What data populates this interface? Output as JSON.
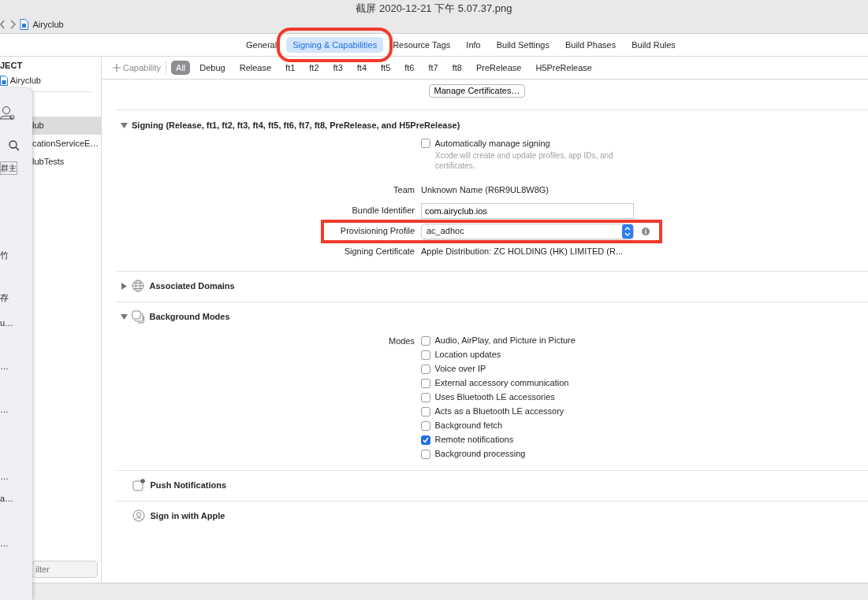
{
  "window": {
    "title": "截屏 2020-12-21 下午 5.07.37.png"
  },
  "toolbar": {
    "breadcrumb": "Airyclub"
  },
  "tabs": [
    {
      "label": "General",
      "selected": false,
      "highlighted": false
    },
    {
      "label": "Signing & Capabilities",
      "selected": true,
      "highlighted": true
    },
    {
      "label": "Resource Tags",
      "selected": false,
      "highlighted": false
    },
    {
      "label": "Info",
      "selected": false,
      "highlighted": false
    },
    {
      "label": "Build Settings",
      "selected": false,
      "highlighted": false
    },
    {
      "label": "Build Phases",
      "selected": false,
      "highlighted": false
    },
    {
      "label": "Build Rules",
      "selected": false,
      "highlighted": false
    }
  ],
  "sidebar": {
    "header": "JECT",
    "project": "Airyclub",
    "items": [
      {
        "label": "lub",
        "selected": true
      },
      {
        "label": "cationServiceE…",
        "selected": false
      },
      {
        "label": "lubTests",
        "selected": false
      }
    ],
    "filter": {
      "placeholder": "ilter"
    }
  },
  "overlay_panel": {
    "tag": "群主",
    "items": [
      "竹",
      "存",
      "u…",
      "…",
      "…",
      "…",
      "a…",
      "…"
    ]
  },
  "capability_bar": {
    "add_button": "Capability",
    "configs": [
      {
        "label": "All",
        "selected": true
      },
      {
        "label": "Debug",
        "selected": false
      },
      {
        "label": "Release",
        "selected": false
      },
      {
        "label": "ft1",
        "selected": false
      },
      {
        "label": "ft2",
        "selected": false
      },
      {
        "label": "ft3",
        "selected": false
      },
      {
        "label": "ft4",
        "selected": false
      },
      {
        "label": "ft5",
        "selected": false
      },
      {
        "label": "ft6",
        "selected": false
      },
      {
        "label": "ft7",
        "selected": false
      },
      {
        "label": "ft8",
        "selected": false
      },
      {
        "label": "PreRelease",
        "selected": false
      },
      {
        "label": "H5PreRelease",
        "selected": false
      }
    ]
  },
  "manage_button": "Manage Certificates…",
  "sections": [
    {
      "kind": "signing",
      "title": "Signing (Release, ft1, ft2, ft3, ft4, ft5, ft6, ft7, ft8, PreRelease, and H5PreRelease)",
      "expanded": true,
      "auto_manage": {
        "label": "Automatically manage signing",
        "hint": "Xcode will create and update profiles, app IDs, and certificates.",
        "checked": false
      },
      "rows": [
        {
          "kind": "text",
          "label": "Team",
          "value": "Unknown Name (R6R9UL8W8G)"
        },
        {
          "kind": "input",
          "label": "Bundle Identifier",
          "value": "com.airyclub.ios"
        },
        {
          "kind": "select",
          "label": "Provisioning Profile",
          "value": "ac_adhoc",
          "highlighted": true
        },
        {
          "kind": "text",
          "label": "Signing Certificate",
          "value": "Apple Distribution: ZC HOLDING (HK) LIMITED (R..."
        }
      ]
    },
    {
      "kind": "domains",
      "title": "Associated Domains",
      "expanded": false
    },
    {
      "kind": "modes",
      "title": "Background Modes",
      "expanded": true,
      "label": "Modes",
      "options": [
        {
          "label": "Audio, AirPlay, and Picture in Picture",
          "checked": false
        },
        {
          "label": "Location updates",
          "checked": false
        },
        {
          "label": "Voice over IP",
          "checked": false
        },
        {
          "label": "External accessory communication",
          "checked": false
        },
        {
          "label": "Uses Bluetooth LE accessories",
          "checked": false
        },
        {
          "label": "Acts as a Bluetooth LE accessory",
          "checked": false
        },
        {
          "label": "Background fetch",
          "checked": false
        },
        {
          "label": "Remote notifications",
          "checked": true
        },
        {
          "label": "Background processing",
          "checked": false
        }
      ]
    },
    {
      "kind": "push",
      "title": "Push Notifications"
    },
    {
      "kind": "signin",
      "title": "Sign in with Apple"
    }
  ]
}
